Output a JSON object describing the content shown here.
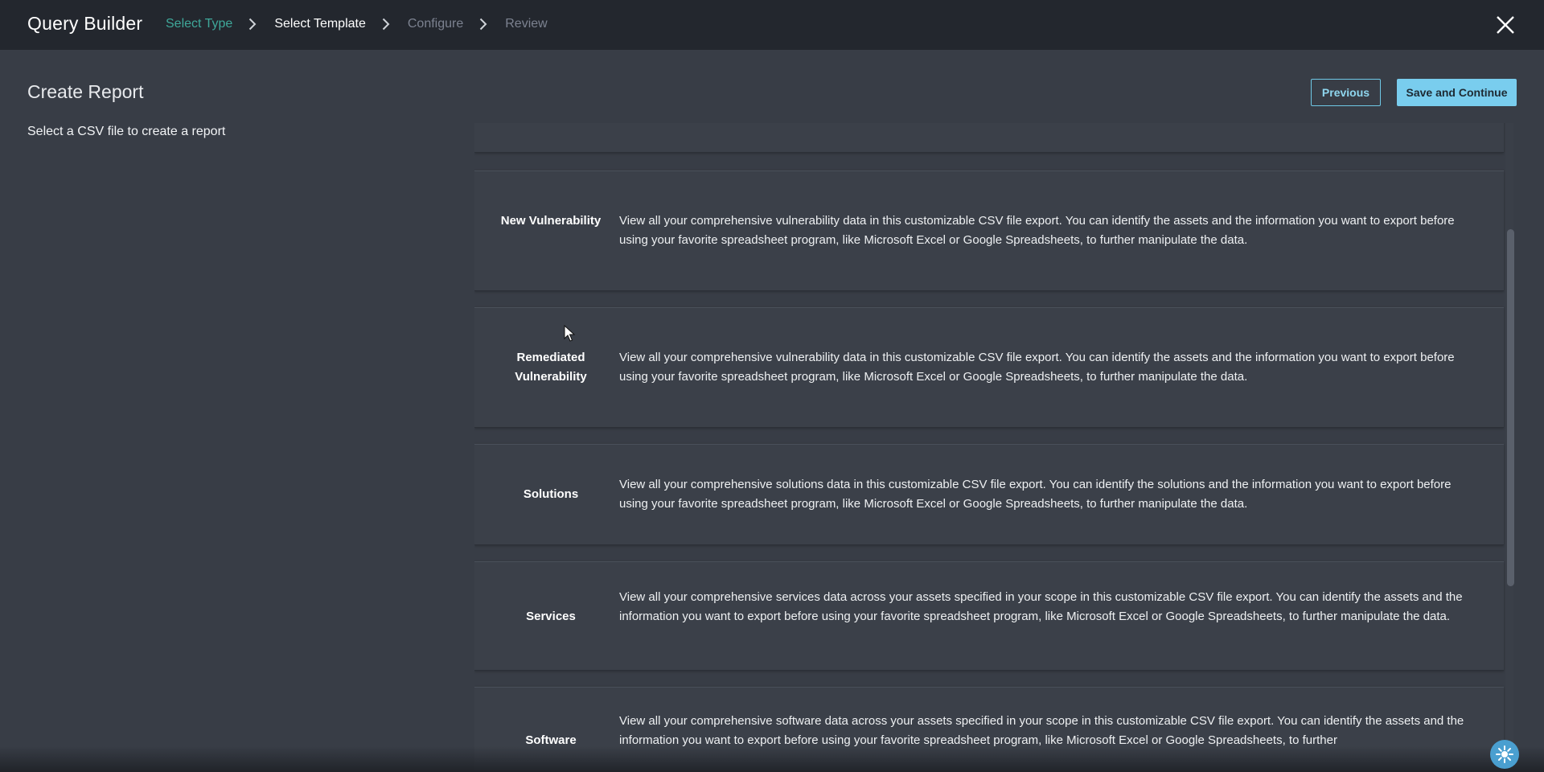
{
  "header": {
    "app_title": "Query Builder",
    "steps": [
      {
        "label": "Select Type",
        "state": "done"
      },
      {
        "label": "Select Template",
        "state": "active"
      },
      {
        "label": "Configure",
        "state": "todo"
      },
      {
        "label": "Review",
        "state": "todo"
      }
    ],
    "close_icon": "close-icon"
  },
  "main": {
    "page_title": "Create Report",
    "subtitle": "Select a CSV file to create a report",
    "previous_label": "Previous",
    "save_label": "Save and Continue"
  },
  "templates": [
    {
      "name": "New Vulnerability",
      "description": "View all your comprehensive vulnerability data in this customizable CSV file export. You can identify the assets and the information you want to export before using your favorite spreadsheet program, like Microsoft Excel or Google Spreadsheets, to further manipulate the data."
    },
    {
      "name": "Remediated Vulnerability",
      "description": "View all your comprehensive vulnerability data in this customizable CSV file export. You can identify the assets and the information you want to export before using your favorite spreadsheet program, like Microsoft Excel or Google Spreadsheets, to further manipulate the data."
    },
    {
      "name": "Solutions",
      "description": "View all your comprehensive solutions data in this customizable CSV file export. You can identify the solutions and the information you want to export before using your favorite spreadsheet program, like Microsoft Excel or Google Spreadsheets, to further manipulate the data."
    },
    {
      "name": "Services",
      "description": "View all your comprehensive services data across your assets specified in your scope in this customizable CSV file export. You can identify the assets and the information you want to export before using your favorite spreadsheet program, like Microsoft Excel or Google Spreadsheets, to further manipulate the data."
    },
    {
      "name": "Software",
      "description": "View all your comprehensive software data across your assets specified in your scope in this customizable CSV file export. You can identify the assets and the information you want to export before using your favorite spreadsheet program, like Microsoft Excel or Google Spreadsheets, to further"
    }
  ],
  "colors": {
    "background": "#383d46",
    "topbar": "#23272e",
    "step_done": "#3fa89a",
    "accent": "#79cdee"
  },
  "icons": {
    "close": "close-icon",
    "chevron": "chevron-right-icon",
    "help": "help-widget-icon"
  }
}
